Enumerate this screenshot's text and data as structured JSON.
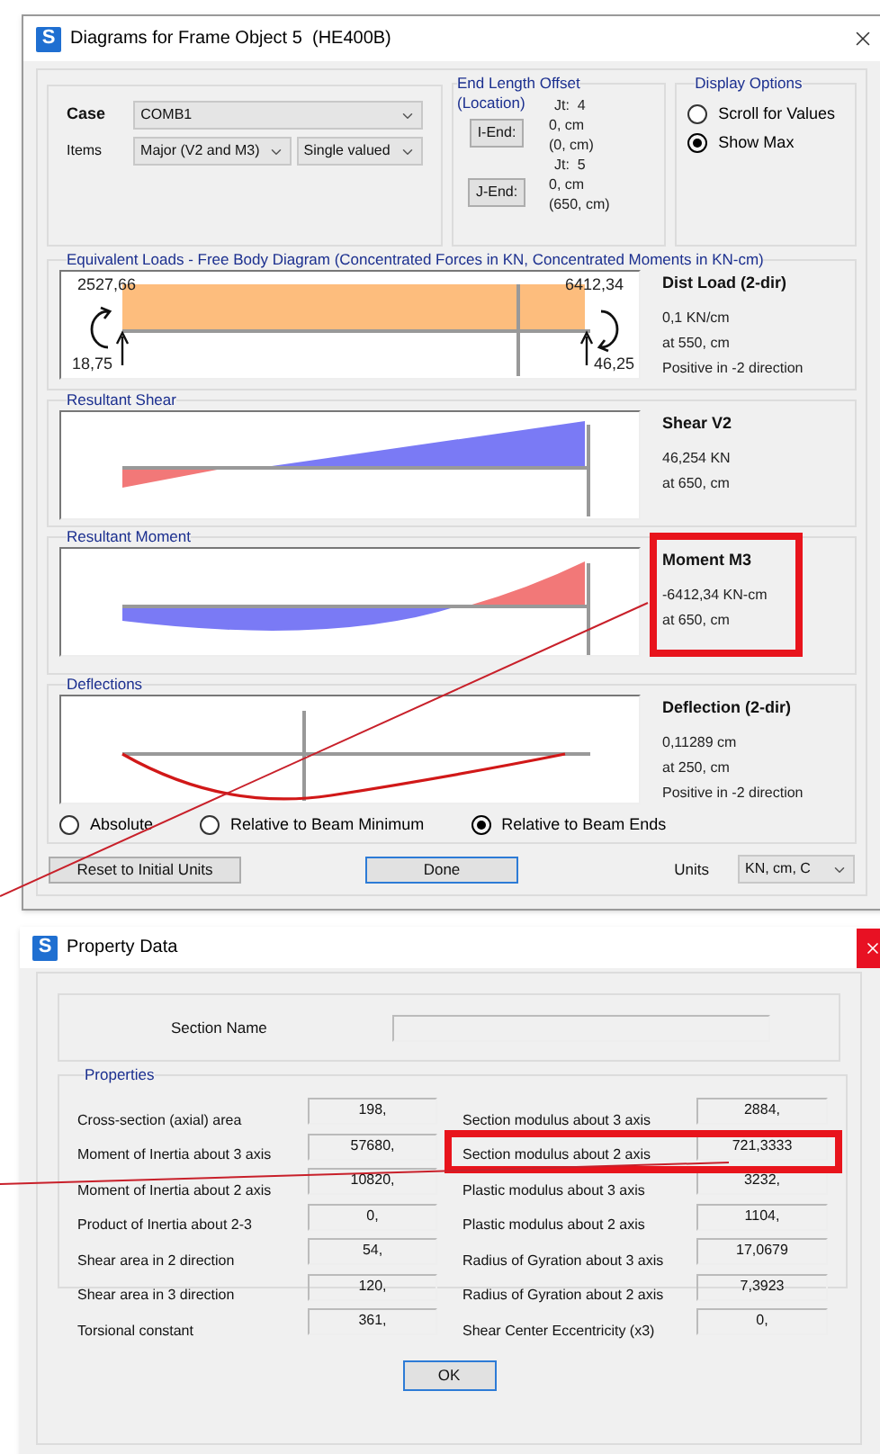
{
  "diagrams_window": {
    "app_icon": "S",
    "title": "Diagrams for Frame Object 5  (HE400B)",
    "case": {
      "label": "Case",
      "value": "COMB1"
    },
    "items": {
      "label": "Items",
      "component": "Major (V2 and M3)",
      "mode": "Single valued"
    },
    "end_length_offset": {
      "title": "End Length Offset",
      "subtitle": "(Location)",
      "ends": [
        {
          "button": "I-End:",
          "joint": "Jt:  4",
          "offset": "0, cm",
          "location": "(0, cm)"
        },
        {
          "button": "J-End:",
          "joint": "Jt:  5",
          "offset": "0, cm",
          "location": "(650, cm)"
        }
      ]
    },
    "display_options": {
      "title": "Display Options",
      "options": [
        {
          "label": "Scroll for Values",
          "selected": false
        },
        {
          "label": "Show Max",
          "selected": true
        }
      ]
    },
    "panels": [
      {
        "kind": "loads",
        "title": "Equivalent Loads - Free Body Diagram  (Concentrated Forces in KN, Concentrated Moments in KN-cm)",
        "labels": [
          "2527,66",
          "6412,34",
          "18,75",
          "46,25"
        ],
        "info_title": "Dist Load (2-dir)",
        "info_lines": [
          "0,1 KN/cm",
          "at 550, cm",
          "Positive in -2 direction"
        ],
        "highlighted": false
      },
      {
        "kind": "shear",
        "title": "Resultant Shear",
        "info_title": "Shear V2",
        "info_lines": [
          "46,254 KN",
          "at 650, cm"
        ],
        "highlighted": false
      },
      {
        "kind": "moment",
        "title": "Resultant Moment",
        "info_title": "Moment M3",
        "info_lines": [
          "-6412,34 KN-cm",
          "at 650, cm"
        ],
        "highlighted": true
      },
      {
        "kind": "deflection",
        "title": "Deflections",
        "info_title": "Deflection (2-dir)",
        "info_lines": [
          "0,11289 cm",
          "at 250, cm",
          "Positive in -2 direction"
        ],
        "highlighted": false
      }
    ],
    "deflection_modes": [
      {
        "label": "Absolute",
        "selected": false
      },
      {
        "label": "Relative to Beam Minimum",
        "selected": false
      },
      {
        "label": "Relative to Beam Ends",
        "selected": true
      }
    ],
    "reset_button": "Reset to Initial Units",
    "done_button": "Done",
    "units": {
      "label": "Units",
      "value": "KN, cm, C"
    }
  },
  "property_window": {
    "app_icon": "S",
    "title": "Property Data",
    "section_name": {
      "label": "Section Name"
    },
    "properties": {
      "title": "Properties",
      "rows": [
        {
          "label": "Cross-section (axial) area",
          "value": "198,"
        },
        {
          "label": "Moment of Inertia about 3 axis",
          "value": "57680,"
        },
        {
          "label": "Moment of Inertia about 2 axis",
          "value": "10820,"
        },
        {
          "label": "Product of Inertia about 2-3",
          "value": "0,"
        },
        {
          "label": "Shear area in 2 direction",
          "value": "54,"
        },
        {
          "label": "Shear area in 3 direction",
          "value": "120,"
        },
        {
          "label": "Torsional constant",
          "value": "361,"
        }
      ],
      "rows_right": [
        {
          "label": "Section modulus about 3 axis",
          "value": "2884,",
          "highlighted": false
        },
        {
          "label": "Section modulus about 2 axis",
          "value": "721,3333",
          "highlighted": true
        },
        {
          "label": "Plastic modulus about 3 axis",
          "value": "3232,",
          "highlighted": false
        },
        {
          "label": "Plastic modulus about 2 axis",
          "value": "1104,",
          "highlighted": false
        },
        {
          "label": "Radius of Gyration about 3 axis",
          "value": "17,0679",
          "highlighted": false
        },
        {
          "label": "Radius of Gyration about 2 axis",
          "value": "7,3923",
          "highlighted": false
        },
        {
          "label": "Shear Center Eccentricity (x3)",
          "value": "0,",
          "highlighted": false
        }
      ]
    },
    "ok_button": "OK"
  }
}
